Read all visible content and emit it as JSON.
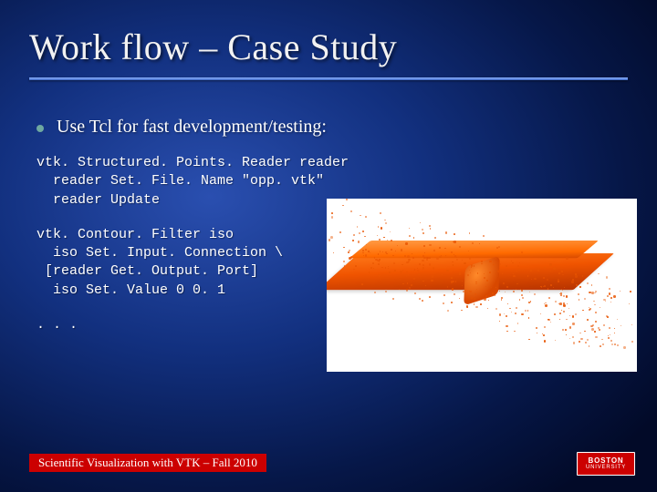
{
  "title": "Work flow – Case Study",
  "bullet": "Use Tcl for fast development/testing:",
  "code1": "vtk. Structured. Points. Reader reader\n  reader Set. File. Name \"opp. vtk\"\n  reader Update",
  "code2": "vtk. Contour. Filter iso\n  iso Set. Input. Connection \\\n [reader Get. Output. Port]\n  iso Set. Value 0 0. 1",
  "code3": ". . .",
  "footer": "Scientific Visualization with VTK – Fall 2010",
  "logo": {
    "top": "BOSTON",
    "bottom": "UNIVERSITY"
  }
}
